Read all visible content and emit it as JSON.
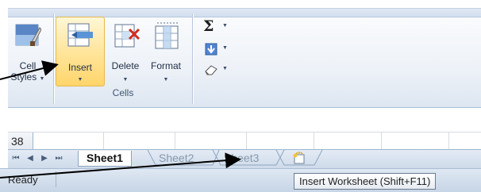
{
  "ribbon": {
    "cell_styles": {
      "line1": "Cell",
      "line2": "Styles"
    },
    "insert": {
      "label": "Insert"
    },
    "delete": {
      "label": "Delete"
    },
    "format": {
      "label": "Format"
    },
    "group_label": "Cells",
    "autosum_icon": "sigma-icon",
    "fill_icon": "fill-down-icon",
    "clear_icon": "eraser-icon"
  },
  "sheet": {
    "row_number": "38",
    "tabs": [
      {
        "label": "Sheet1",
        "active": true
      },
      {
        "label": "Sheet2",
        "active": false
      },
      {
        "label": "Sheet3",
        "active": false
      }
    ],
    "insert_icon": "insert-worksheet-icon"
  },
  "status": {
    "mode": "Ready",
    "tooltip": "Insert Worksheet (Shift+F11)"
  },
  "colors": {
    "highlight": "#ffd56a",
    "arrow": "#000000",
    "ribbon_bg": "#eef2f8"
  }
}
